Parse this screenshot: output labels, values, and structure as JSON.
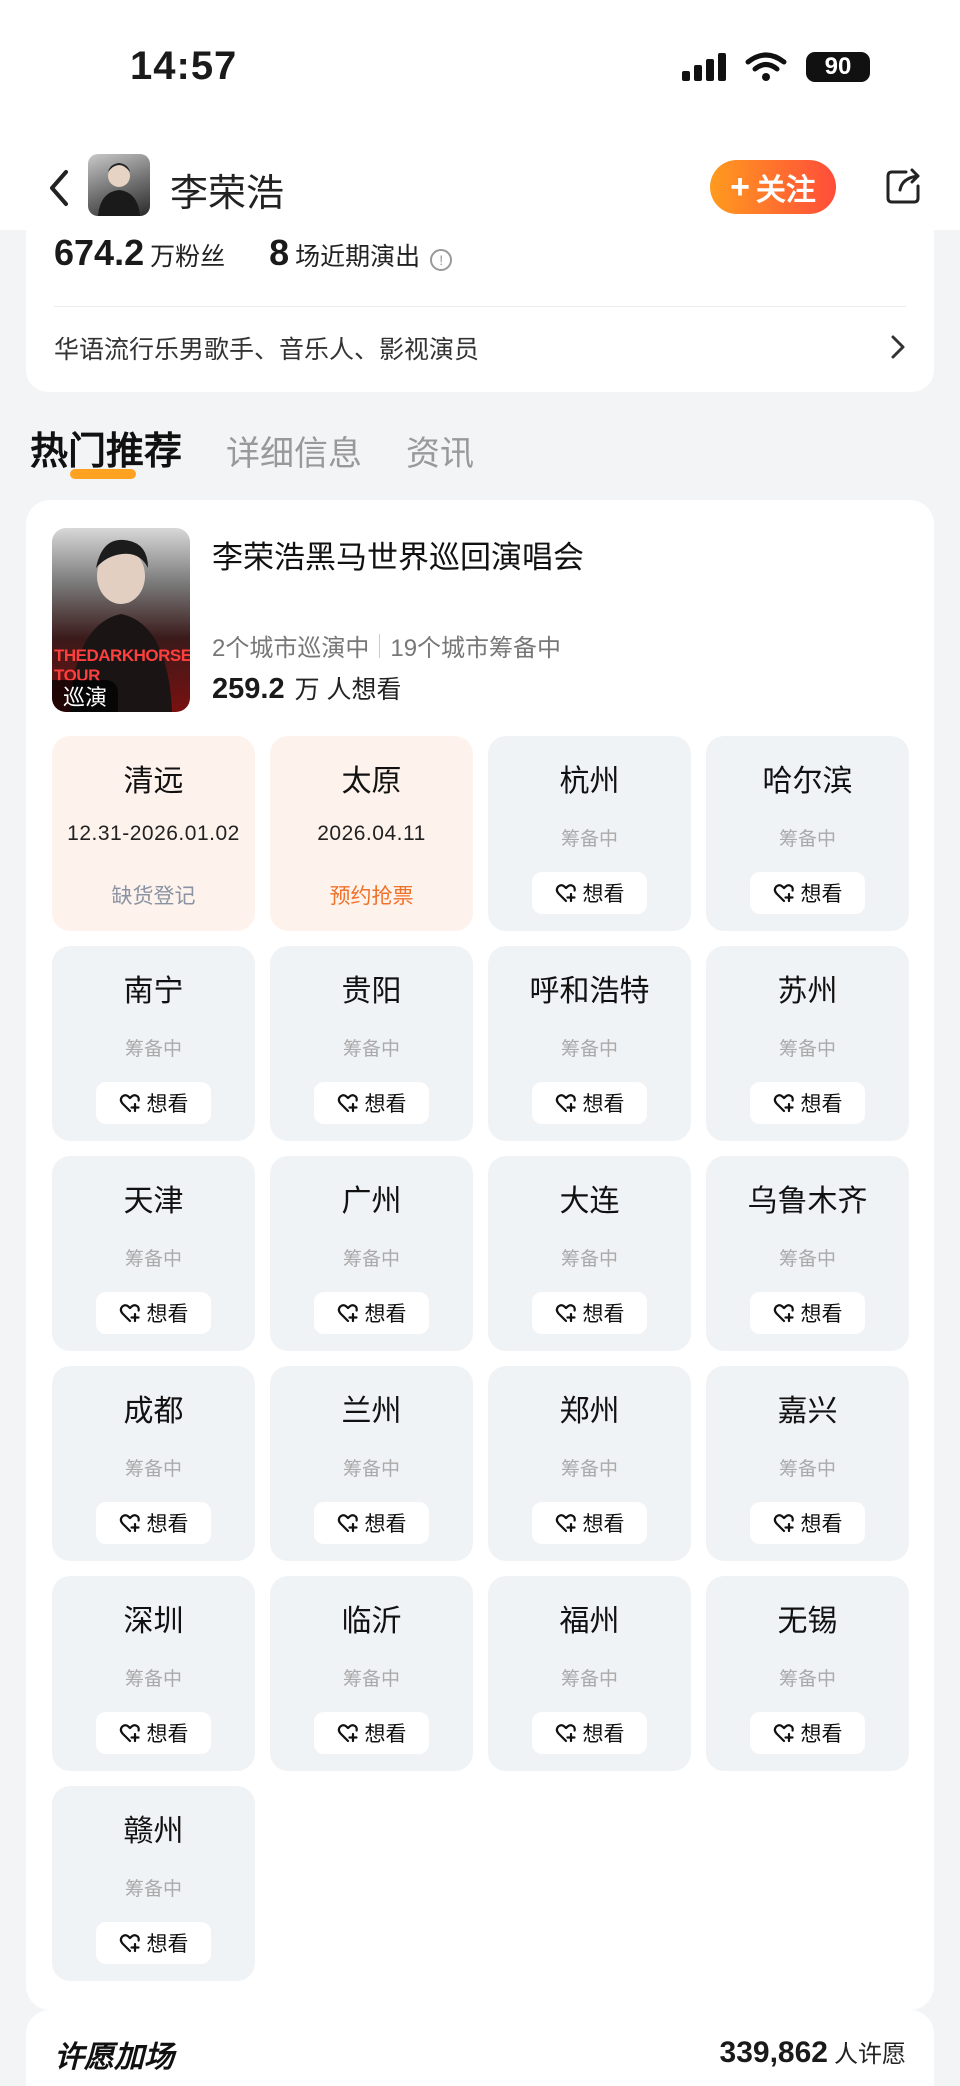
{
  "status_bar": {
    "time": "14:57",
    "battery": "90"
  },
  "nav": {
    "name": "李荣浩",
    "follow_label": "关注"
  },
  "stats": {
    "fans_num": "674.2",
    "fans_label": "万粉丝",
    "shows_num": "8",
    "shows_label": "场近期演出"
  },
  "intro": "华语流行乐男歌手、音乐人、影视演员",
  "tabs": [
    "热门推荐",
    "详细信息",
    "资讯"
  ],
  "event": {
    "title": "李荣浩黑马世界巡回演唱会",
    "touring": "2个城市巡演中",
    "preparing": "19个城市筹备中",
    "want_num": "259.2",
    "want_label": "万 人想看",
    "poster_text": "THEDARKHORSE TOUR",
    "badge": "巡演"
  },
  "want_btn_label": "想看",
  "cities": [
    {
      "name": "清远",
      "date": "12.31-2026.01.02",
      "action": "缺货登记",
      "type": "gray"
    },
    {
      "name": "太原",
      "date": "2026.04.11",
      "action": "预约抢票",
      "type": "orange"
    },
    {
      "name": "杭州",
      "status": "筹备中"
    },
    {
      "name": "哈尔滨",
      "status": "筹备中"
    },
    {
      "name": "南宁",
      "status": "筹备中"
    },
    {
      "name": "贵阳",
      "status": "筹备中"
    },
    {
      "name": "呼和浩特",
      "status": "筹备中"
    },
    {
      "name": "苏州",
      "status": "筹备中"
    },
    {
      "name": "天津",
      "status": "筹备中"
    },
    {
      "name": "广州",
      "status": "筹备中"
    },
    {
      "name": "大连",
      "status": "筹备中"
    },
    {
      "name": "乌鲁木齐",
      "status": "筹备中"
    },
    {
      "name": "成都",
      "status": "筹备中"
    },
    {
      "name": "兰州",
      "status": "筹备中"
    },
    {
      "name": "郑州",
      "status": "筹备中"
    },
    {
      "name": "嘉兴",
      "status": "筹备中"
    },
    {
      "name": "深圳",
      "status": "筹备中"
    },
    {
      "name": "临沂",
      "status": "筹备中"
    },
    {
      "name": "福州",
      "status": "筹备中"
    },
    {
      "name": "无锡",
      "status": "筹备中"
    },
    {
      "name": "赣州",
      "status": "筹备中"
    }
  ],
  "bottom": {
    "title": "许愿加场",
    "count": "339,862",
    "label": "人许愿"
  }
}
